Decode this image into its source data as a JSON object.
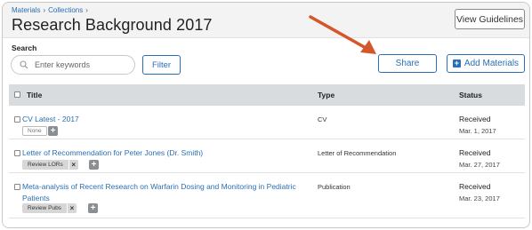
{
  "header": {
    "breadcrumb": [
      "Materials",
      "Collections"
    ],
    "title": "Research Background 2017",
    "guidelines_button": "View Guidelines"
  },
  "search": {
    "label": "Search",
    "placeholder": "Enter keywords",
    "filter_button": "Filter"
  },
  "actions": {
    "share_button": "Share",
    "add_button": "Add Materials"
  },
  "table": {
    "columns": [
      "Title",
      "Type",
      "Status"
    ],
    "rows": [
      {
        "title": "CV Latest - 2017",
        "type": "CV",
        "status": "Received",
        "date": "Mar. 1, 2017",
        "tag": "None"
      },
      {
        "title": "Letter of Recommendation for Peter Jones (Dr. Smith)",
        "type": "Letter of Recommendation",
        "status": "Received",
        "date": "Mar. 27, 2017",
        "tag": "Review LORs"
      },
      {
        "title": "Meta-analysis of Recent Research on Warfarin Dosing and Monitoring in Pediatric Patients",
        "type": "Publication",
        "status": "Received",
        "date": "Mar. 23, 2017",
        "tag": "Review Pubs"
      }
    ]
  },
  "colors": {
    "accent": "#2a6fb5",
    "arrow": "#d4572b",
    "header_bg": "#f3f3f3",
    "table_head_bg": "#d9dcdf"
  }
}
